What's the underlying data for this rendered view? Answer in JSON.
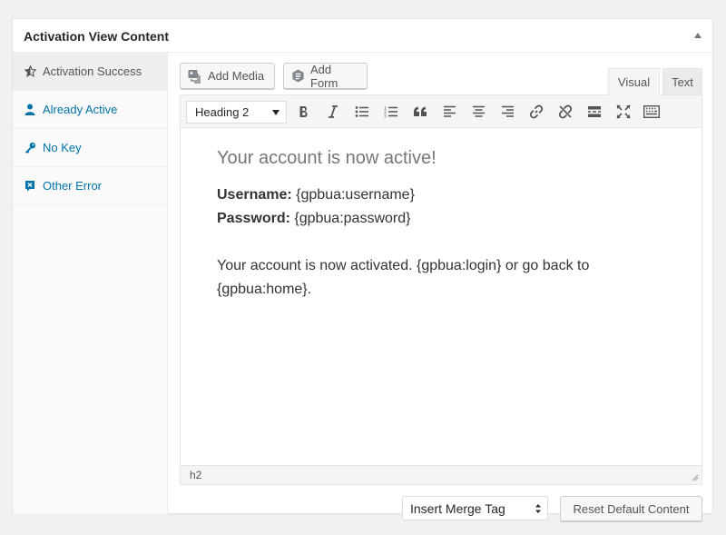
{
  "panel": {
    "title": "Activation View Content"
  },
  "tabs": [
    {
      "label": "Activation Success",
      "icon": "star-half-icon",
      "active": true
    },
    {
      "label": "Already Active",
      "icon": "user-icon",
      "active": false
    },
    {
      "label": "No Key",
      "icon": "key-icon",
      "active": false
    },
    {
      "label": "Other Error",
      "icon": "error-icon",
      "active": false
    }
  ],
  "media_buttons": {
    "add_media": "Add Media",
    "add_form": "Add Form"
  },
  "editor_modes": {
    "visual": "Visual",
    "text": "Text"
  },
  "toolbar": {
    "format_value": "Heading 2"
  },
  "content": {
    "heading": "Your account is now active!",
    "username_label": "Username:",
    "username_value": " {gpbua:username}",
    "password_label": "Password:",
    "password_value": " {gpbua:password}",
    "line1": "Your account is now activated. {gpbua:login} or go back to",
    "line2": "{gpbua:home}."
  },
  "statusbar": {
    "path": "h2"
  },
  "actions": {
    "merge_tag": "Insert Merge Tag",
    "reset": "Reset Default Content"
  },
  "colors": {
    "link": "#0073aa",
    "icon": "#555555",
    "border": "#e5e5e5"
  }
}
